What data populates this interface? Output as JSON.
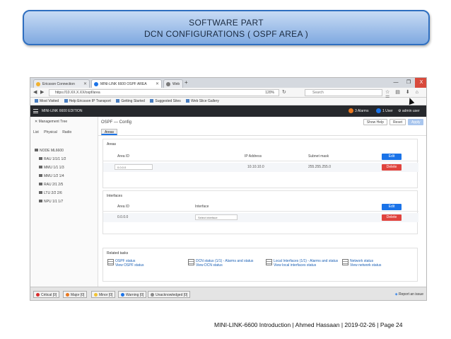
{
  "slide": {
    "title_line1": "SOFTWARE PART",
    "title_line2": "DCN CONFIGURATIONS ( OSPF AREA )",
    "footer": "MINI-LINK-6600 Introduction | Ahmed Hassaan | 2019-02-26 | Page 24"
  },
  "browser": {
    "tabs": [
      {
        "label": "Ericsson Connection",
        "icon": "warning-icon",
        "color": "#f1b12f"
      },
      {
        "label": "MINI-LINK 6600 OSPF AREA",
        "icon": "ericsson-icon",
        "color": "#1a73e8"
      },
      {
        "label": "Web",
        "icon": "page-icon",
        "color": "#7a7a7a"
      }
    ],
    "new_tab": "+",
    "window_buttons": [
      "—",
      "❐",
      "X"
    ],
    "url": "https://10.XX.X.XX/ospf/area",
    "zoom": "120%",
    "search_placeholder": "Search",
    "bookmarks": [
      "Most Visited",
      "Help Ericsson IP Transport",
      "Getting Started",
      "Suggested Sites",
      "Web Slice Gallery"
    ]
  },
  "app": {
    "brand": "MINI-LINK 6600 EDITION",
    "alarms": "3 Alarms",
    "alarms_color": "#e8771f",
    "users": "1 User",
    "users_color": "#1a73e8",
    "user_name": "admin user"
  },
  "left_panel": {
    "title": "Management Tree",
    "tabs": [
      "List",
      "Physical",
      "Radio"
    ],
    "tree": [
      "NODE ML6600",
      "RAU 1/1/1 1/2",
      "MMU 1/1 1/3",
      "MMU 1/2 1/4",
      "RAU 2/1 2/5",
      "LTU 2/2 2/6",
      "NPU 1/1 1/7"
    ]
  },
  "main": {
    "breadcrumb": "OSPF — Config",
    "tools": [
      "Show Help",
      "Reset"
    ],
    "apply": "Apply",
    "subtab": "Areas",
    "areas": {
      "title": "Areas",
      "headers": [
        "Area ID",
        "IP Address",
        "Subnet mask"
      ],
      "row": {
        "area_id": "0.0.0.0",
        "ip": "10.10.10.0",
        "mask": "255.255.255.0"
      },
      "edit": "Edit",
      "delete": "Delete"
    },
    "interfaces": {
      "title": "Interfaces",
      "headers": [
        "Area ID",
        "Interface"
      ],
      "row": {
        "area_id": "0.0.0.0",
        "interface": "Select interface"
      },
      "edit": "Edit",
      "delete": "Delete"
    },
    "related": {
      "title": "Related tasks",
      "items": [
        {
          "line1": "OSPF status",
          "line2": "View OSPF status"
        },
        {
          "line1": "DCN status (1/1) - Alarms and status",
          "line2": "View DCN status"
        },
        {
          "line1": "Local Interfaces (1/1) - Alarms and status",
          "line2": "View local interfaces status"
        },
        {
          "line1": "Network status",
          "line2": "View network status"
        }
      ]
    }
  },
  "taskbar": {
    "items": [
      {
        "label": "Critical [0]",
        "color": "#d92c2c"
      },
      {
        "label": "Major [0]",
        "color": "#e8771f"
      },
      {
        "label": "Minor [0]",
        "color": "#f1c232"
      },
      {
        "label": "Warning [0]",
        "color": "#1a73e8"
      },
      {
        "label": "Unacknowledged [0]",
        "color": "#888888"
      }
    ],
    "right": "Report an issue"
  }
}
